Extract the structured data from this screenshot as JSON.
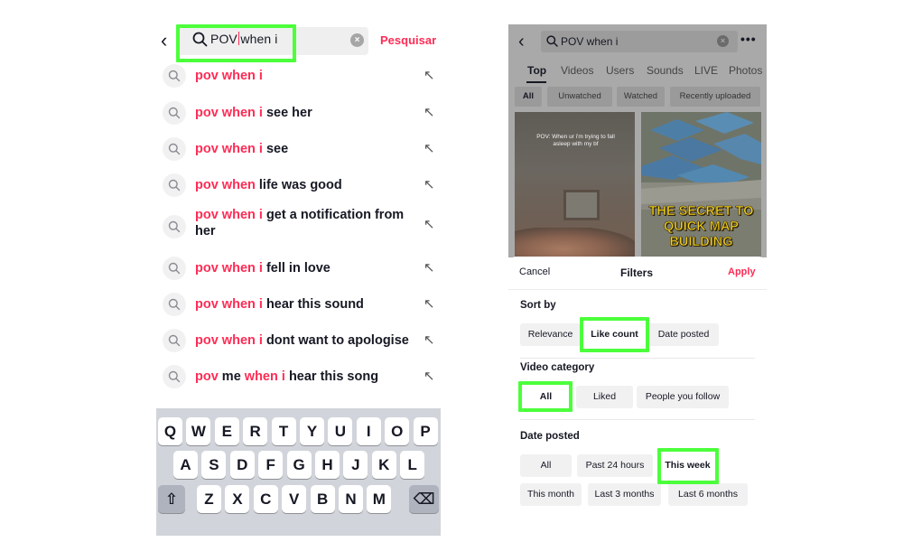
{
  "colors": {
    "accent_pink": "#fe2c55",
    "highlight_green": "#4cff3b"
  },
  "left": {
    "search": {
      "query_before_caret": "POV",
      "query_after_caret": "when i",
      "action_label": "Pesquisar"
    },
    "suggestions": [
      {
        "highlight": "pov when i",
        "rest": "",
        "rest2": ""
      },
      {
        "highlight": "pov when i",
        "rest": " see her",
        "rest2": ""
      },
      {
        "highlight": "pov when i",
        "rest": " see",
        "rest2": ""
      },
      {
        "highlight": "pov when",
        "rest": " life was good",
        "rest2": ""
      },
      {
        "highlight": "pov when i",
        "rest": " get a notification from her",
        "rest2": ""
      },
      {
        "highlight": "pov when i",
        "rest": " fell in love",
        "rest2": ""
      },
      {
        "highlight": "pov when i",
        "rest": " hear this sound",
        "rest2": ""
      },
      {
        "highlight": "pov when i",
        "rest": " dont want to apologise",
        "rest2": ""
      },
      {
        "highlight": "pov",
        "mid": " me ",
        "highlight2": "when i",
        "rest": " hear this song"
      }
    ],
    "keyboard": {
      "row1": [
        "Q",
        "W",
        "E",
        "R",
        "T",
        "Y",
        "U",
        "I",
        "O",
        "P"
      ],
      "row2": [
        "A",
        "S",
        "D",
        "F",
        "G",
        "H",
        "J",
        "K",
        "L"
      ],
      "row3": [
        "Z",
        "X",
        "C",
        "V",
        "B",
        "N",
        "M"
      ]
    }
  },
  "right": {
    "search": {
      "query": "POV when i",
      "more": "•••"
    },
    "tabs": [
      "Top",
      "Videos",
      "Users",
      "Sounds",
      "LIVE",
      "Photos"
    ],
    "chips": [
      "All",
      "Unwatched",
      "Watched",
      "Recently uploaded"
    ],
    "thumb1_caption": "POV: When ur i'm trying to fall asleep with my bf",
    "thumb2_caption": "THE SECRET TO QUICK MAP BUILDING",
    "filters": {
      "cancel": "Cancel",
      "title": "Filters",
      "apply": "Apply",
      "sort_by": {
        "title": "Sort by",
        "options": [
          "Relevance",
          "Like count",
          "Date posted"
        ]
      },
      "video_category": {
        "title": "Video category",
        "options": [
          "All",
          "Liked",
          "People you follow"
        ]
      },
      "date_posted": {
        "title": "Date posted",
        "options": [
          "All",
          "Past 24 hours",
          "This week",
          "This month",
          "Last 3 months",
          "Last 6 months"
        ]
      }
    }
  }
}
